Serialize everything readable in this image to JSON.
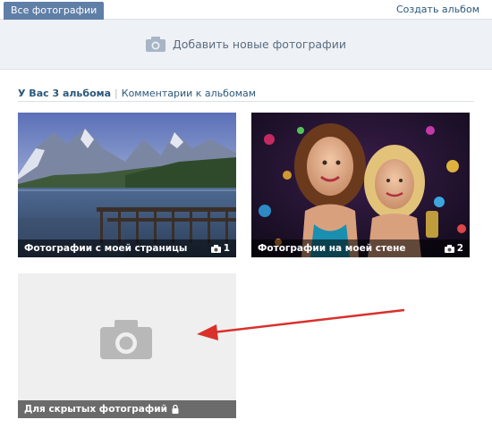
{
  "tabs": {
    "all_photos": "Все фотографии"
  },
  "create_album": "Создать альбом",
  "upload": {
    "label": "Добавить новые фотографии"
  },
  "albums_header": {
    "count_label": "У Вас 3 альбома",
    "separator": "|",
    "comments_label": "Комментарии к альбомам"
  },
  "albums": [
    {
      "title": "Фотографии с моей страницы",
      "count": "1"
    },
    {
      "title": "Фотографии на моей стене",
      "count": "2"
    },
    {
      "title": "Для скрытых фотографий",
      "count": ""
    }
  ],
  "colors": {
    "accent": "#5f7fa7",
    "link": "#2b587a",
    "arrow": "#d9302b"
  },
  "icons": [
    "camera-icon",
    "lock-icon"
  ]
}
